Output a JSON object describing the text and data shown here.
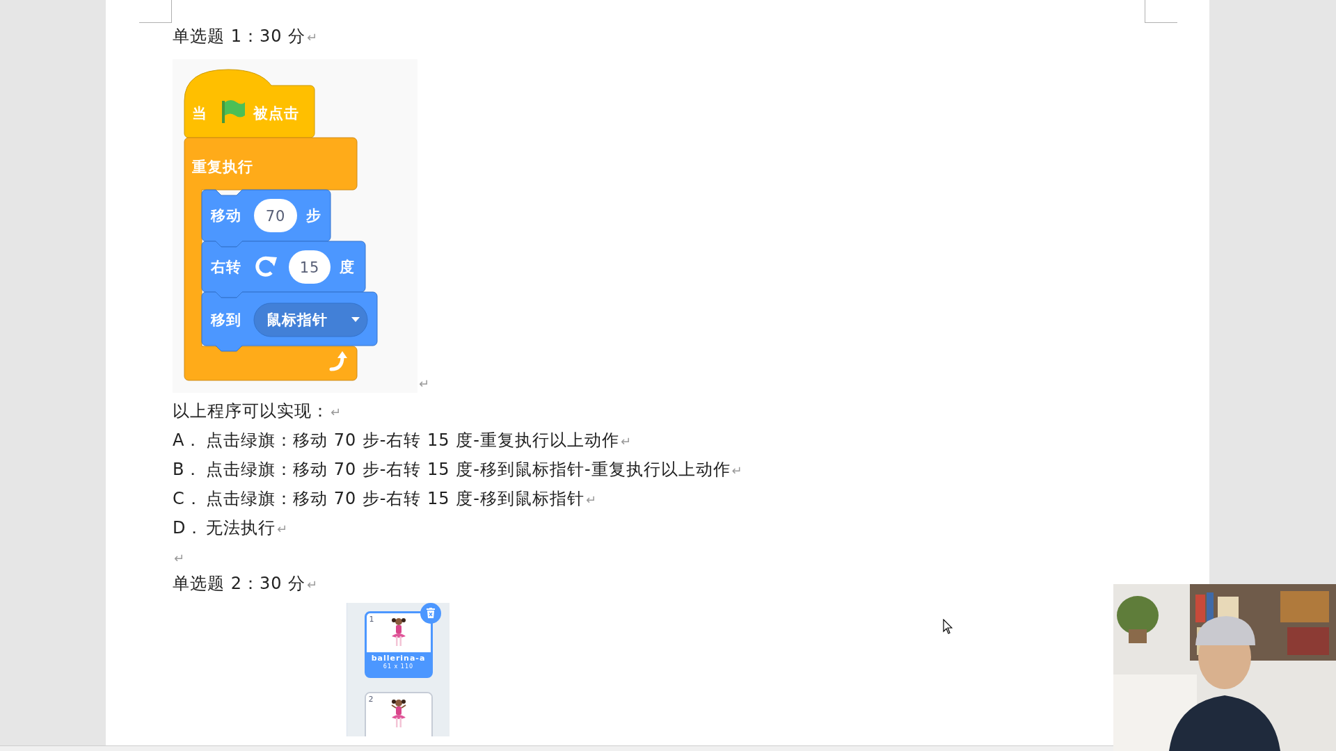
{
  "question_1": {
    "heading": "单选题 1：30 分",
    "heading_mark": "↵",
    "script": {
      "hat": {
        "kind": "flag_clicked",
        "before": "当",
        "after": "被点击"
      },
      "loop": {
        "kind": "forever",
        "label": "重复执行",
        "children": [
          {
            "kind": "number_input",
            "label": "移动",
            "value": "70",
            "unit": "步"
          },
          {
            "kind": "turn_input",
            "label": "右转",
            "value": "15",
            "unit": "度"
          },
          {
            "kind": "menu_input",
            "label": "移到",
            "value": "鼠标指针"
          }
        ]
      }
    },
    "figure_mark": "↵",
    "prompt": "以上程序可以实现：",
    "prompt_mark": "↵",
    "options": [
      {
        "letter": "A．",
        "text": "点击绿旗：移动 70 步-右转 15 度-重复执行以上动作",
        "mark": "↵"
      },
      {
        "letter": "B．",
        "text": "点击绿旗：移动 70 步-右转 15 度-移到鼠标指针-重复执行以上动作",
        "mark": "↵"
      },
      {
        "letter": "C．",
        "text": "点击绿旗：移动 70 步-右转 15 度-移到鼠标指针",
        "mark": "↵"
      },
      {
        "letter": "D．",
        "text": "无法执行",
        "mark": "↵"
      }
    ],
    "blank_mark": "↵"
  },
  "question_2": {
    "heading": "单选题 2：30 分",
    "heading_mark": "↵",
    "costumes": [
      {
        "number": "1",
        "name": "ballerina-a",
        "size": "61 x 110",
        "selected": true
      },
      {
        "number": "2",
        "selected": false
      }
    ]
  }
}
